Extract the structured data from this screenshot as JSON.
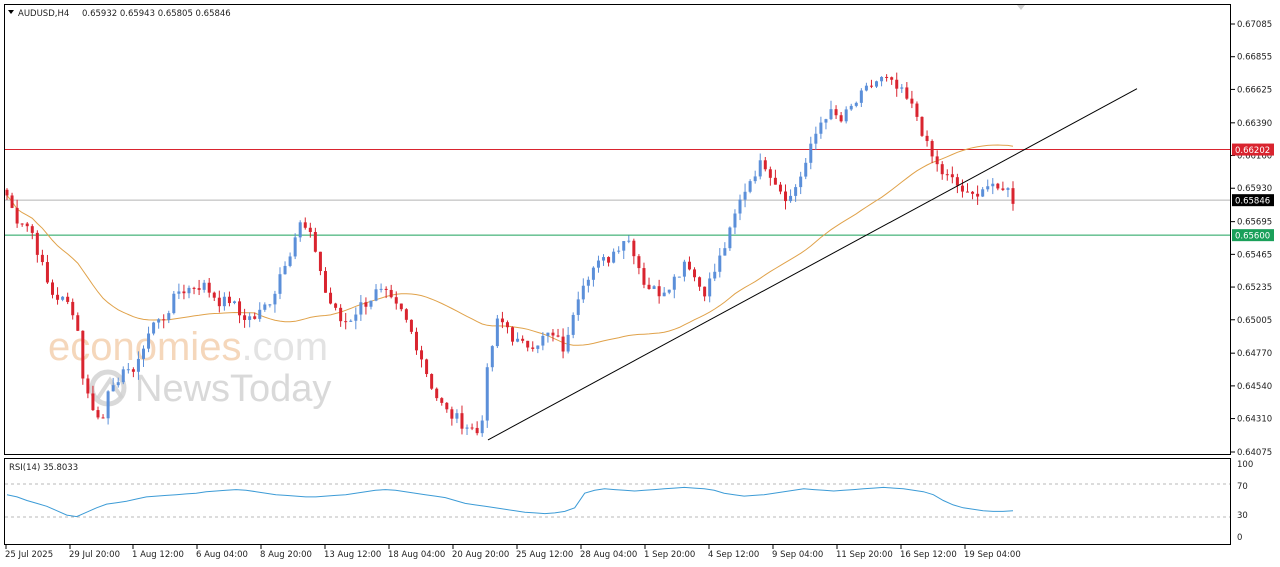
{
  "header": {
    "symbol_line": "AUDUSD,H4",
    "ohlc_line": "0.65932 0.65943 0.65805 0.65846"
  },
  "watermark": {
    "line1_orange": "economies",
    "line1_gray": ".com",
    "line2": "NewsToday"
  },
  "colors": {
    "bull": "#5b8fd9",
    "bear": "#d9242f",
    "ma": "#e0a24a",
    "resistance": "#d9242f",
    "support": "#1aa05a",
    "trendline": "#000000",
    "rsi": "#3c9bd6"
  },
  "chart_data": [
    {
      "type": "candlestick",
      "title": "AUDUSD,H4",
      "ylim": [
        0.64075,
        0.6718
      ],
      "y_ticks": [
        "0.67085",
        "0.66855",
        "0.66625",
        "0.66390",
        "0.66160",
        "0.65930",
        "0.65695",
        "0.65465",
        "0.65235",
        "0.65005",
        "0.64770",
        "0.64540",
        "0.64310",
        "0.64075"
      ],
      "x_ticks": [
        "25 Jul 2025",
        "29 Jul 20:00",
        "1 Aug 12:00",
        "6 Aug 04:00",
        "8 Aug 20:00",
        "13 Aug 12:00",
        "18 Aug 04:00",
        "20 Aug 20:00",
        "25 Aug 12:00",
        "28 Aug 04:00",
        "1 Sep 20:00",
        "4 Sep 12:00",
        "9 Sep 04:00",
        "11 Sep 20:00",
        "16 Sep 12:00",
        "19 Sep 04:00"
      ],
      "levels": [
        {
          "label": "0.66202",
          "value": 0.66202,
          "kind": "resistance"
        },
        {
          "label": "0.65600",
          "value": 0.656,
          "kind": "support"
        },
        {
          "label": "0.65846",
          "value": 0.65846,
          "kind": "current"
        }
      ],
      "trendline": {
        "from": [
          "20 Aug 20:00",
          0.6416
        ],
        "to": [
          "after 19 Sep 04:00",
          0.6663
        ]
      },
      "anchors": [
        [
          0.6588,
          0.6572
        ],
        [
          0.657,
          0.6561
        ],
        [
          0.654,
          0.652
        ],
        [
          0.6516,
          0.6512
        ],
        [
          0.6505,
          0.6452
        ],
        [
          0.644,
          0.6425
        ],
        [
          0.6462,
          0.6452
        ],
        [
          0.647,
          0.6462
        ],
        [
          0.6486,
          0.6498
        ],
        [
          0.65,
          0.651
        ],
        [
          0.6521,
          0.6522
        ],
        [
          0.6525,
          0.6524
        ],
        [
          0.6518,
          0.6512
        ],
        [
          0.6515,
          0.6504
        ],
        [
          0.6502,
          0.6502
        ],
        [
          0.651,
          0.6518
        ],
        [
          0.6538,
          0.655
        ],
        [
          0.6568,
          0.6562
        ],
        [
          0.6548,
          0.652
        ],
        [
          0.6508,
          0.6498
        ],
        [
          0.6502,
          0.651
        ],
        [
          0.6514,
          0.652
        ],
        [
          0.6518,
          0.651
        ],
        [
          0.6505,
          0.6492
        ],
        [
          0.6478,
          0.646
        ],
        [
          0.6446,
          0.6436
        ],
        [
          0.6432,
          0.6428
        ],
        [
          0.6424,
          0.642
        ],
        [
          0.647,
          0.6498
        ],
        [
          0.6498,
          0.6486
        ],
        [
          0.6482,
          0.6484
        ],
        [
          0.6486,
          0.649
        ],
        [
          0.6486,
          0.6478
        ],
        [
          0.6512,
          0.6528
        ],
        [
          0.6536,
          0.654
        ],
        [
          0.6544,
          0.6552
        ],
        [
          0.656,
          0.6548
        ],
        [
          0.6528,
          0.6522
        ],
        [
          0.652,
          0.6526
        ],
        [
          0.6532,
          0.6545
        ],
        [
          0.653,
          0.652
        ],
        [
          0.653,
          0.6545
        ],
        [
          0.656,
          0.658
        ],
        [
          0.6595,
          0.6605
        ],
        [
          0.6612,
          0.6602
        ],
        [
          0.6592,
          0.6585
        ],
        [
          0.6598,
          0.6612
        ],
        [
          0.663,
          0.6645
        ],
        [
          0.6645,
          0.664
        ],
        [
          0.6648,
          0.6655
        ],
        [
          0.6662,
          0.6668
        ],
        [
          0.667,
          0.6665
        ],
        [
          0.666,
          0.6652
        ],
        [
          0.6642,
          0.6622
        ],
        [
          0.661,
          0.6602
        ],
        [
          0.6598,
          0.6592
        ],
        [
          0.6585,
          0.6592
        ],
        [
          0.6595,
          0.659
        ],
        [
          0.6596,
          0.6585
        ]
      ]
    },
    {
      "type": "line",
      "title": "RSI(14) 35.8033",
      "series_name": "RSI(14)",
      "ylim": [
        0,
        100
      ],
      "y_ticks": [
        "100",
        "70",
        "30",
        "0"
      ],
      "levels": [
        70,
        30
      ],
      "values": [
        58,
        55,
        50,
        46,
        42,
        36,
        30,
        28,
        34,
        40,
        45,
        47,
        49,
        52,
        55,
        56,
        57,
        58,
        59,
        60,
        62,
        63,
        64,
        65,
        64,
        62,
        60,
        58,
        57,
        56,
        55,
        55,
        56,
        57,
        58,
        60,
        62,
        64,
        65,
        64,
        62,
        60,
        58,
        56,
        54,
        50,
        46,
        44,
        42,
        40,
        38,
        36,
        34,
        33,
        32,
        33,
        35,
        40,
        60,
        64,
        66,
        65,
        64,
        63,
        64,
        65,
        66,
        67,
        68,
        67,
        66,
        64,
        60,
        58,
        56,
        57,
        58,
        60,
        62,
        64,
        66,
        65,
        64,
        63,
        64,
        65,
        66,
        67,
        68,
        67,
        66,
        64,
        62,
        58,
        50,
        44,
        40,
        38,
        36,
        35,
        35,
        36
      ]
    }
  ]
}
